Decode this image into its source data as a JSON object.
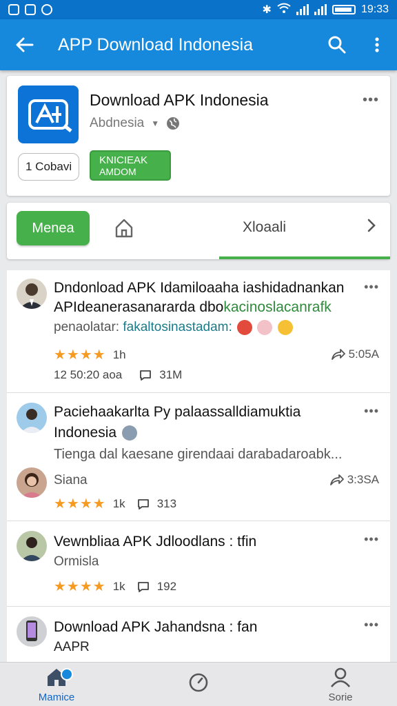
{
  "status_bar": {
    "time": "19:33"
  },
  "app_bar": {
    "title": "APP Download Indonesia"
  },
  "app_card": {
    "name": "Download APK Indonesia",
    "developer": "Abdnesia",
    "pill_label": "1 Cobavi",
    "install_line1": "KNICIEAK",
    "install_line2": "AMDOM"
  },
  "tabs": {
    "active_tab": "Menea",
    "tab_label": "Xloaali"
  },
  "posts": [
    {
      "title_line1": "Dndonload APK Idamiloaaha iashidadnankan",
      "title_line2a": "APIdeanerasanararda dbo",
      "title_line2b": "kacinoslacanrafk",
      "sub_a": "penaolatar: ",
      "sub_b": "fakaltosinastadam:",
      "rating_text": "1h",
      "share_count": "5:05A",
      "time": "12 50:20 aoa",
      "comments": "31M"
    },
    {
      "title_line1": "Paciehaakarlta Py palaassalldiamuktia",
      "title_line2": "Indonesia",
      "sub": "Tienga dal kaesane girendaai darabadaroabk...",
      "author": "Siana",
      "share_count": "3:3SA",
      "rating_text": "1k",
      "comments": "313"
    },
    {
      "title_line1": "Vewnbliaa APK Jdloodlans : tfin",
      "title_line2": "Ormisla",
      "rating_text": "1k",
      "comments": "192"
    },
    {
      "title_line1": "Download APK Jahandsna : fan",
      "title_line2": "AAPR"
    }
  ],
  "bottom_nav": {
    "home_label": "Mamice",
    "profile_label": "Sorie"
  },
  "colors": {
    "primary": "#1789dc",
    "accent_green": "#46b04a",
    "star": "#f59a23"
  }
}
